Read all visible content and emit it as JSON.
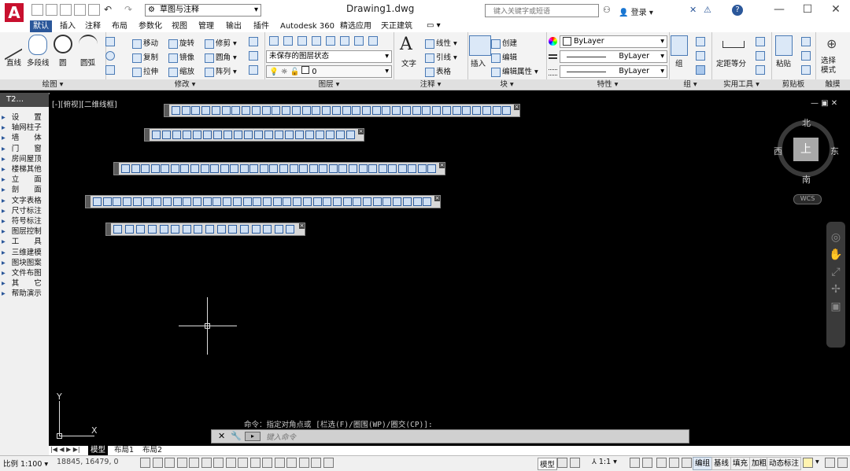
{
  "app": {
    "window_title": "Drawing1.dwg",
    "workspace": "草图与注释",
    "search_placeholder": "键入关键字或短语",
    "login": "登录"
  },
  "tabs": [
    {
      "label": "默认",
      "active": true
    },
    {
      "label": "插入"
    },
    {
      "label": "注释"
    },
    {
      "label": "布局"
    },
    {
      "label": "参数化"
    },
    {
      "label": "视图"
    },
    {
      "label": "管理"
    },
    {
      "label": "输出"
    },
    {
      "label": "插件"
    },
    {
      "label": "Autodesk 360"
    },
    {
      "label": "精选应用"
    },
    {
      "label": "天正建筑"
    }
  ],
  "ribbon": {
    "draw": {
      "label": "绘图 ▾",
      "line": "直线",
      "polyline": "多段线",
      "circle": "圆",
      "arc": "圆弧"
    },
    "modify": {
      "label": "修改 ▾",
      "move": "移动",
      "rotate": "旋转",
      "trim": "修剪 ▾",
      "copy": "复制",
      "mirror": "镜像",
      "fillet": "圆角 ▾",
      "stretch": "拉伸",
      "scale": "缩放",
      "array": "阵列 ▾"
    },
    "layer": {
      "label": "图层 ▾",
      "state": "未保存的图层状态",
      "current": "0"
    },
    "annotation": {
      "label": "注释 ▾",
      "text": "文字",
      "dim_linear": "线性 ▾",
      "leader": "引线 ▾",
      "table": "表格"
    },
    "block": {
      "label": "块 ▾",
      "insert": "插入",
      "create": "创建",
      "edit": "编辑",
      "edit_attr": "编辑属性 ▾"
    },
    "properties": {
      "label": "特性 ▾",
      "color": "ByLayer",
      "linetype": "ByLayer",
      "lineweight": "ByLayer"
    },
    "group": {
      "label": "组 ▾",
      "group": "组"
    },
    "utilities": {
      "label": "实用工具 ▾",
      "measure": "定距等分"
    },
    "clipboard": {
      "label": "剪贴板",
      "paste": "粘贴"
    },
    "touch": {
      "label": "触摸",
      "select_mode": "选择\n模式",
      "select_mode_l1": "选择",
      "select_mode_l2": "模式"
    }
  },
  "viewport_label": "[-][俯视][二维线框]",
  "palette": {
    "title": "T2...",
    "items": [
      "设　　置",
      "轴网柱子",
      "墙　　体",
      "门　　窗",
      "房间屋顶",
      "楼梯其他",
      "立　　面",
      "剖　　面",
      "文字表格",
      "尺寸标注",
      "符号标注",
      "图层控制",
      "工　　具",
      "三维建模",
      "图块图案",
      "文件布图",
      "其　　它",
      "帮助演示"
    ]
  },
  "viewcube": {
    "north": "北",
    "south": "南",
    "east": "东",
    "west": "西",
    "top": "上",
    "wcs": "WCS"
  },
  "command": {
    "history": "命令：指定对角点或 [栏选(F)/圈围(WP)/圈交(CP)]:",
    "placeholder": "键入命令"
  },
  "layout_tabs": [
    "模型",
    "布局1",
    "布局2"
  ],
  "status": {
    "scale": "比例 1:100 ▾",
    "coords": "18845, 16479, 0",
    "model": "模型",
    "anno_scale": "1:1 ▾",
    "buttons": [
      "编组",
      "基线",
      "填充",
      "加粗",
      "动态标注"
    ]
  }
}
